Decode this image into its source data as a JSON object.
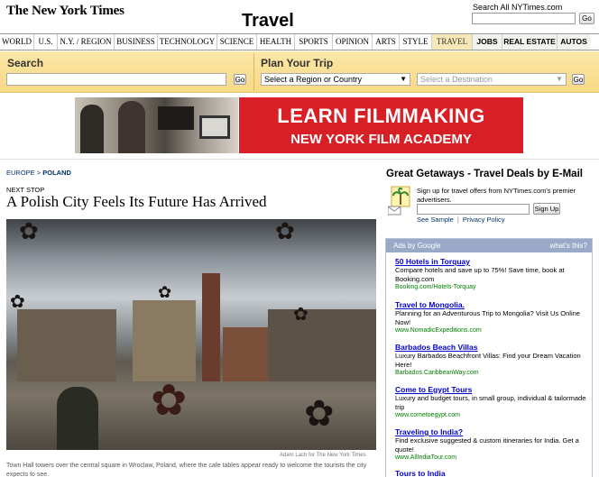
{
  "header": {
    "logo": "The New York Times",
    "section_title": "Travel",
    "search_all_label": "Search All NYTimes.com",
    "search_go": "Go"
  },
  "nav": {
    "items": [
      "WORLD",
      "U.S.",
      "N.Y. / REGION",
      "BUSINESS",
      "TECHNOLOGY",
      "SCIENCE",
      "HEALTH",
      "SPORTS",
      "OPINION",
      "ARTS",
      "STYLE",
      "TRAVEL",
      "JOBS",
      "REAL ESTATE",
      "AUTOS"
    ],
    "active": "TRAVEL"
  },
  "travel_search": {
    "search_label": "Search",
    "search_go": "Go",
    "plan_label": "Plan Your Trip",
    "region_select": "Select a Region or Country",
    "destination_select": "Select a Destination",
    "plan_go": "Go"
  },
  "ad_banner": {
    "line1": "LEARN FILMMAKING",
    "line2": "NEW YORK FILM ACADEMY"
  },
  "article": {
    "breadcrumb_parent": "EUROPE",
    "breadcrumb_sep": ">",
    "breadcrumb_current": "POLAND",
    "kicker": "NEXT STOP",
    "headline": "A Polish City Feels Its Future Has Arrived",
    "photo_credit": "Adam Lach for The New York Times",
    "caption": "Town Hall towers over the central square in Wroclaw, Poland, where the cafe tables appear ready to welcome the tourists the city expects to see."
  },
  "getaways": {
    "title": "Great Getaways - Travel Deals by E-Mail",
    "description": "Sign up for travel offers from NYTimes.com's premier advertisers.",
    "signup_label": "Sign Up",
    "see_sample": "See Sample",
    "link_sep": "|",
    "privacy_policy": "Privacy Policy"
  },
  "google_ads": {
    "header": "Ads by Google",
    "whats_this": "what's this?",
    "ads": [
      {
        "title": "50 Hotels in Torquay",
        "desc": "Compare hotels and save up to 75%! Save time, book at Booking.com",
        "url": "Booking.com/Hotels-Torquay"
      },
      {
        "title": "Travel to Mongolia.",
        "desc": "Planning for an Adventurous Trip to Mongolia? Visit Us Online Now!",
        "url": "www.NomadicExpeditions.com"
      },
      {
        "title": "Barbados Beach Villas",
        "desc": "Luxury Barbados Beachfront Villas: Find your Dream Vacation Here!",
        "url": "Barbados.CaribbeanWay.com"
      },
      {
        "title": "Come to Egypt Tours",
        "desc": "Luxury and budget tours, in small group, individual & tailormade trip",
        "url": "www.cometoegypt.com"
      },
      {
        "title": "Traveling to India?",
        "desc": "Find exclusive suggested & custom itineraries for India. Get a quote!",
        "url": "www.AllIndiaTour.com"
      },
      {
        "title": "Tours to India",
        "desc": "",
        "url": ""
      }
    ]
  },
  "colors": {
    "band": "#f8d985",
    "ad_red": "#d91f26",
    "ads_header": "#9aa9c7",
    "link": "#0000cc",
    "ad_url": "#008000"
  }
}
